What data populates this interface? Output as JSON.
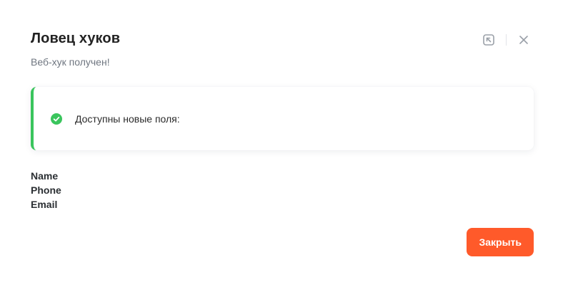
{
  "modal": {
    "title": "Ловец хуков",
    "subtitle": "Веб-хук получен!"
  },
  "header_actions": {
    "icons": [
      "open-in-window-icon",
      "close-icon"
    ]
  },
  "alert": {
    "icon": "check-circle-icon",
    "text": "Доступны новые поля:",
    "accent_color": "#3ac55d"
  },
  "fields": [
    "Name",
    "Phone",
    "Email"
  ],
  "footer": {
    "close_label": "Закрыть",
    "button_color": "#ff5a2a"
  }
}
